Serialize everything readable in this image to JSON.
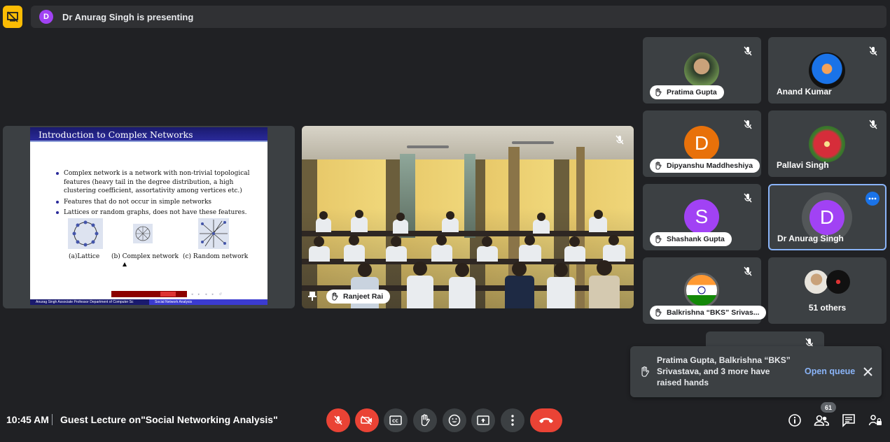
{
  "banner": {
    "initial": "D",
    "text": "Dr Anurag Singh is presenting"
  },
  "slide": {
    "title": "Introduction to Complex Networks",
    "bullets": [
      "Complex network is a network with non-trivial topological features (heavy tail in the degree distribution, a high clustering coefficient, assortativity among vertices etc.)",
      "Features that do not occur in simple networks",
      "Lattices or random graphs, does not have these features."
    ],
    "captions": [
      "(a)Lattice",
      "(b) Complex network",
      "(c) Random network"
    ],
    "footer_left": "Anurag Singh Associate Professor Department of Computer Sc",
    "footer_right": "Social Network Analysis"
  },
  "video": {
    "name": "Ranjeet Rai"
  },
  "participants": [
    {
      "name": "Pratima Gupta",
      "chip": true
    },
    {
      "name": "Anand Kumar",
      "chip": false
    },
    {
      "name": "Dipyanshu Maddheshiya",
      "initial": "D",
      "color": "#e8710a",
      "chip": true
    },
    {
      "name": "Pallavi Singh",
      "chip": false
    },
    {
      "name": "Shashank Gupta",
      "initial": "S",
      "color": "#a142f4",
      "chip": true
    },
    {
      "name": "Dr Anurag Singh",
      "initial": "D",
      "color": "#a142f4",
      "chip": false
    },
    {
      "name": "Balkrishna “BKS” Srivas...",
      "chip": true
    },
    {
      "name": "51 others",
      "chip": false
    }
  ],
  "toast": {
    "message": "Pratima Gupta, Balkrishna “BKS” Srivastava, and 3 more have raised hands",
    "action": "Open queue"
  },
  "bottom": {
    "time": "10:45 AM",
    "meeting_title": "Guest Lecture on\"Social Networking Analysis\"",
    "participant_count": "61"
  },
  "colors": {
    "accent": "#8ab4f8",
    "danger": "#ea4335",
    "present": "#fbbc04"
  }
}
